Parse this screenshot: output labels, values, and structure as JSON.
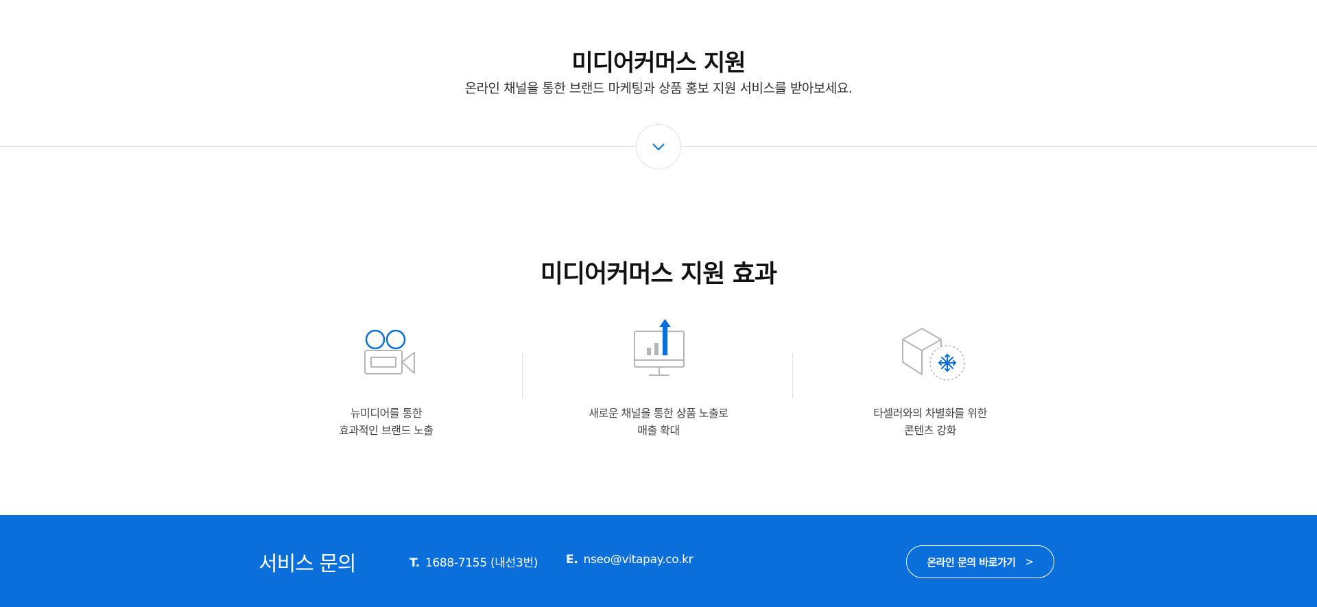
{
  "hero": {
    "title": "미디어커머스 지원",
    "subtitle": "온라인 채널을 통한 브랜드 마케팅과 상품 홍보 지원 서비스를 받아보세요."
  },
  "effects": {
    "title_prefix": "미디어커머스 지원",
    "title_bold": "효과",
    "items": [
      {
        "icon": "video-camera-icon",
        "line1": "뉴미디어를 통한",
        "line2": "효과적인 브랜드 노출"
      },
      {
        "icon": "monitor-growth-chart-icon",
        "line1": "새로운 채널을 통한 상품 노출로",
        "line2": "매출 확대"
      },
      {
        "icon": "box-differentiation-icon",
        "line1": "타셀러와의 차별화를 위한",
        "line2": "콘텐츠 강화"
      }
    ]
  },
  "footer": {
    "title": "서비스 문의",
    "tel_label": "T.",
    "tel_value": "1688-7155 (내선3번)",
    "email_label": "E.",
    "email_value": "nseo@vitapay.co.kr",
    "button_label": "온라인 문의 바로가기",
    "button_chevron": ">"
  },
  "colors": {
    "accent": "#0a6fdb",
    "icon_gray": "#b5b5b5",
    "divider": "#e2e2e2"
  }
}
